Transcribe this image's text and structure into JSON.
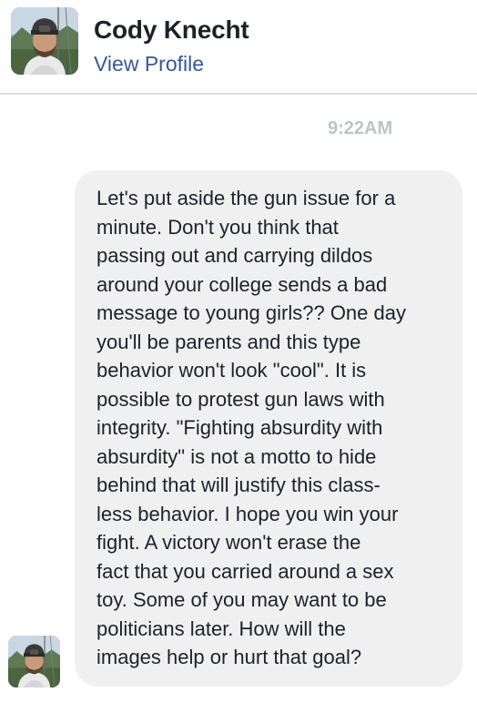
{
  "header": {
    "name": "Cody Knecht",
    "profile_link": "View Profile"
  },
  "conversation": {
    "timestamp": "9:22AM",
    "message": {
      "lines": [
        "Let's put aside the gun issue for a",
        "minute. Don't you think that",
        "passing out and carrying dildos",
        "around your college sends a bad",
        "message to young girls?? One day",
        "you'll be parents and this type",
        "behavior won't look \"cool\". It is",
        "possible to protest gun laws with",
        "integrity. \"Fighting absurdity with",
        "absurdity\" is not a motto to hide",
        "behind that will justify this class-",
        "less behavior. I hope you win your",
        "fight. A victory won't erase the",
        "fact that you carried around a sex",
        "toy. Some of you may want to be",
        "politicians later. How will the",
        "images help or hurt that goal?"
      ]
    }
  },
  "colors": {
    "name": "#1d2129",
    "link": "#365899",
    "timestamp": "#bec3c9",
    "bubble": "#f1f0f0",
    "divider": "#dddfe2"
  },
  "icons": {
    "header_avatar": "profile-photo",
    "message_avatar": "profile-photo"
  }
}
